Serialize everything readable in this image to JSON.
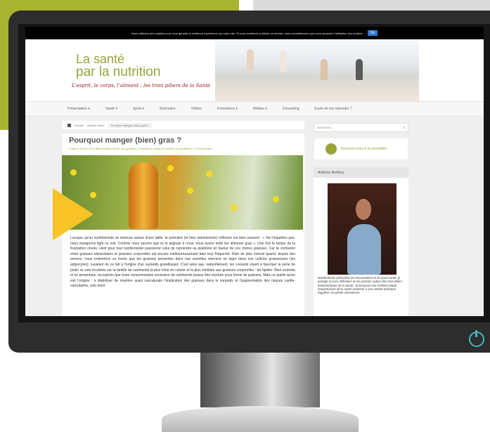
{
  "cookie_banner": {
    "text": "Nous utilisons des cookies pour vous garantir la meilleure expérience sur notre site. Si vous continuez à utiliser ce dernier, nous considérerons que vous acceptez l'utilisation des cookies.",
    "ok_label": "Ok"
  },
  "site": {
    "title_line1": "La santé",
    "title_line2": "par la nutrition",
    "tagline": "L'esprit, le corps, l'aliment : les trois piliers de la Santé"
  },
  "nav": {
    "items": [
      "Présentation ▾",
      "Santé ▾",
      "Sport ▾",
      "Sommaire",
      "Vidéos",
      "Formations ▾",
      "Médias ▾",
      "Consulting",
      "Envie de me répondre ?"
    ]
  },
  "breadcrumb": {
    "home": "Accueil",
    "category": "Articles Santé",
    "current": "Pourquoi manger (bien) gras ?"
  },
  "post": {
    "title": "Pourquoi manger (bien) gras ?",
    "meta": "Posté le 30 Avr 2015 dans Articles Santé, Au quotidien, Conseils en santé et nutrition au quotidien | 3 Commentaire",
    "body": "Lorsque qu'un nutritionniste se retrouve autour d'une table, la première (et bien intentionnée) réflexion est bien souvent : « Ne t'inquiètes pas, nous mangeons light ce soir. Comme nous savons que tu te joignais à nous, nous avons évité les aliments gras ». Une fois le temps de la frustration révolu, vient pour tout nutritionniste passionné celui de reprendre sa plaidoirie en faveur de ces chères graisses. Car la confusion entre graisses alimentaires et graisses corporelles est encore malheureusement bien trop fréquente. Rien de plus normal quand, depuis des années, nous entendons ou lisons que les graisses présentes dans nos assiettes viennent se loger dans nos cellules graisseuses (les adipocytes), cavalant de ce fait à l'origine d'un surpoids grandissant. C'est ainsi que, naturellement, les conseils visant à favoriser la perte de poids se sont focalisés sur la famille de nutriments la plus riche en calorie et la plus similaire aux graisses corporelles : les lipides. Bien entendu et en préambule, acceptons que toute consommation excessive de nutriments puisse être stockée sous forme de graisses. Mais ce quelle qu'en soit l'origine : à diaboliser de manière aussi caricaturale l'implication des graisses dans le surpoids et l'augmentation des risques cardio-vasculaires, cela omet"
  },
  "sidebar": {
    "search_placeholder": "Recherche…",
    "newsletter_label": "Inscrivez-vous à la newsletter",
    "author_heading": "Anthony Berthou",
    "author_bio": "Nutritionniste spécialisé en micronutrition et en sport-santé, je partage ici mes réflexions et ma passion autour des trois piliers fondamentaux de la Santé : promouvoir une nutrition-plaisir respectueuse de la santé associée à une activité physique régulière, en pleine conscience."
  },
  "colors": {
    "brand_green": "#9aa33a",
    "accent_yellow": "#f7c326",
    "backdrop_green": "#a6b42f",
    "power_led": "#43b7c2"
  }
}
